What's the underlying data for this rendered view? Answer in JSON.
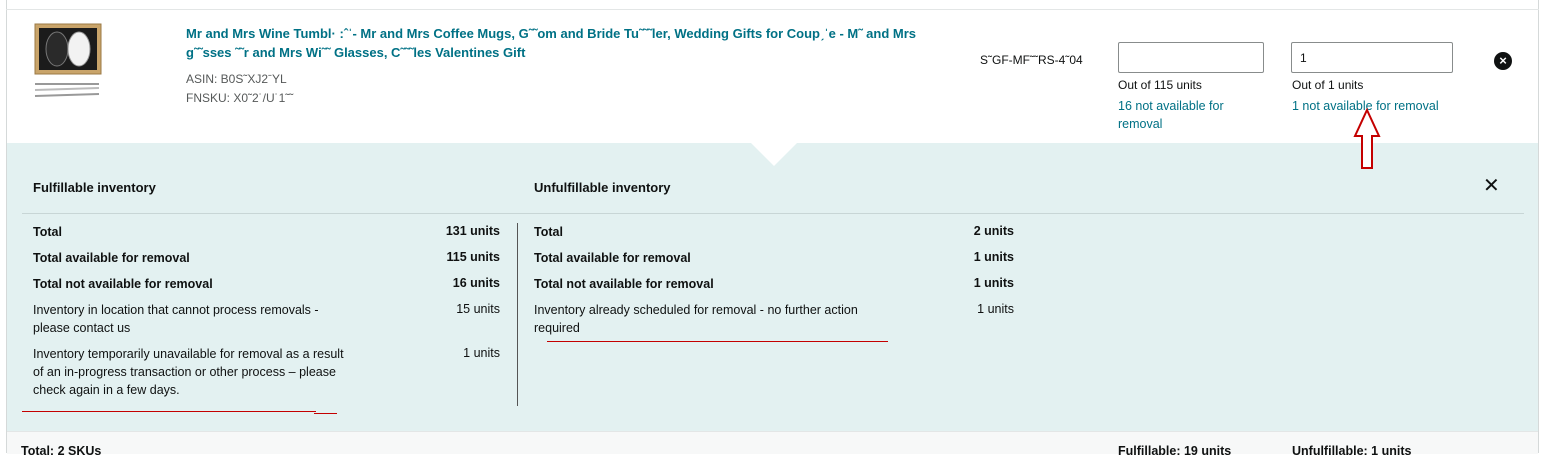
{
  "product": {
    "title": "Mr and Mrs Wine Tumbl· :ˆˈ- Mr and Mrs Coffee Mugs, G˜˜om and Bride Tu˜˜˜ler, Wedding Gifts for Coupˏˈe - M˜ and Mrs g˜˜sses ˜˜r and Mrs Wi˜˜ Glasses, C˜˜˜les Valentines Gift",
    "asin_text": "ASIN: B0S˜XJ2ˉYL",
    "fnsku_text": "FNSKU: X0˜2˙/U˙1˜˜",
    "sku": "S˜GF-MF˜˜RS-4˜04"
  },
  "removal": {
    "col1": {
      "value": "",
      "out_of": "Out of 115 units",
      "not_available": "16 not available for removal"
    },
    "col2": {
      "value": "1",
      "out_of": "Out of 1 units",
      "not_available": "1 not available for removal"
    }
  },
  "panel": {
    "fulfillable": {
      "heading": "Fulfillable inventory",
      "rows": [
        {
          "label": "Total",
          "value": "131 units"
        },
        {
          "label": "Total available for removal",
          "value": "115 units"
        },
        {
          "label": "Total not available for removal",
          "value": "16 units"
        },
        {
          "label": "Inventory in location that cannot process removals - please contact us",
          "value": "15 units"
        },
        {
          "label": "Inventory temporarily unavailable for removal as a result of an in-progress transaction or other process – please check again in a few days.",
          "value": "1 units"
        }
      ]
    },
    "unfulfillable": {
      "heading": "Unfulfillable inventory",
      "rows": [
        {
          "label": "Total",
          "value": "2 units"
        },
        {
          "label": "Total available for removal",
          "value": "1 units"
        },
        {
          "label": "Total not available for removal",
          "value": "1 units"
        },
        {
          "label": "Inventory already scheduled for removal - no further action required",
          "value": "1 units"
        }
      ]
    },
    "close_glyph": "✕"
  },
  "footer": {
    "total": "Total: 2 SKUs",
    "fulfillable": "Fulfillable: 19 units",
    "unfulfillable": "Unfulfillable: 1 units"
  },
  "icons": {
    "remove": "close-circle-icon",
    "arrow": "up-arrow-annotation-icon"
  },
  "colors": {
    "link": "#007185",
    "panel_bg": "#e3f1f1",
    "annotation_red": "#c40000"
  }
}
